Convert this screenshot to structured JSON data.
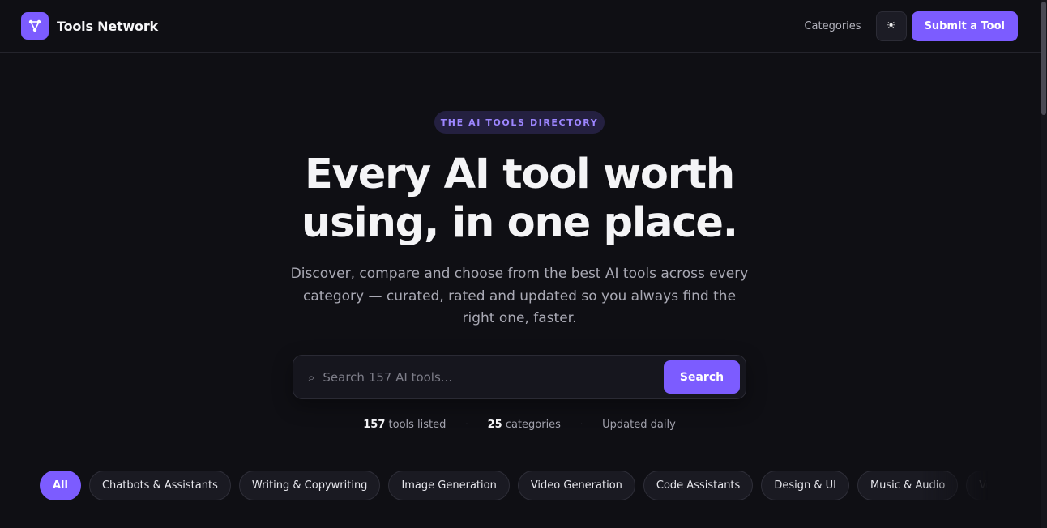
{
  "header": {
    "brand_name": "Tools Network",
    "nav_categories": "Categories",
    "theme_icon": "sun-icon",
    "submit_label": "Submit a Tool"
  },
  "hero": {
    "eyebrow": "THE AI TOOLS DIRECTORY",
    "title_line1": "Every AI tool worth",
    "title_line2": "using, in one place.",
    "subtitle": "Discover, compare and choose from the best AI tools across every category — curated, rated and updated so you always find the right one, faster."
  },
  "search": {
    "placeholder": "Search 157 AI tools...",
    "button_label": "Search"
  },
  "stats": {
    "tools_count": "157",
    "tools_label": "tools listed",
    "categories_count": "25",
    "categories_label": "categories",
    "updated": "Updated daily"
  },
  "categories": [
    {
      "label": "All",
      "active": true
    },
    {
      "label": "Chatbots & Assistants"
    },
    {
      "label": "Writing & Copywriting"
    },
    {
      "label": "Image Generation"
    },
    {
      "label": "Video Generation"
    },
    {
      "label": "Code Assistants"
    },
    {
      "label": "Design & UI"
    },
    {
      "label": "Music & Audio"
    },
    {
      "label": "Voice & Text-to-Speech"
    }
  ],
  "colors": {
    "background": "#0f0f14",
    "accent": "#7c5cff",
    "eyebrow_bg": "#242040",
    "eyebrow_text": "#9d86ff"
  }
}
